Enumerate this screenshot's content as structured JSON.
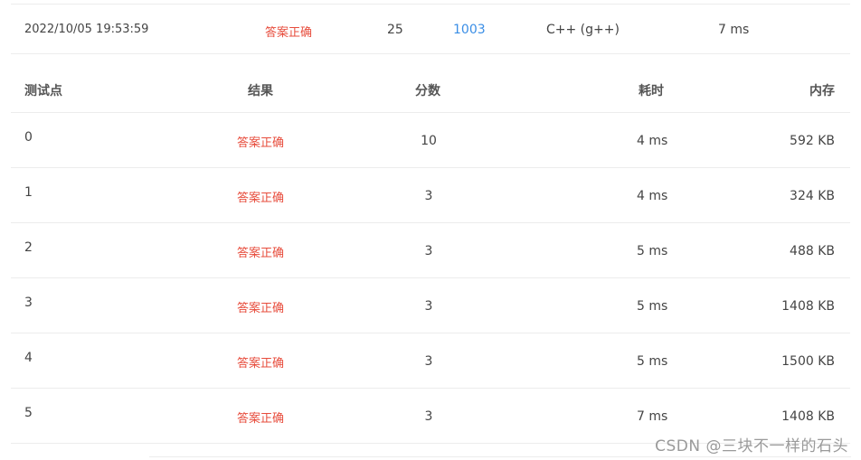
{
  "summary": {
    "submit_time": "2022/10/05 19:53:59",
    "status": "答案正确",
    "score": "25",
    "problem_id": "1003",
    "language": "C++ (g++)",
    "time": "7 ms"
  },
  "table": {
    "headers": {
      "point": "测试点",
      "result": "结果",
      "score": "分数",
      "time": "耗时",
      "memory": "内存"
    },
    "rows": [
      {
        "point": "0",
        "result": "答案正确",
        "score": "10",
        "time": "4 ms",
        "memory": "592 KB"
      },
      {
        "point": "1",
        "result": "答案正确",
        "score": "3",
        "time": "4 ms",
        "memory": "324 KB"
      },
      {
        "point": "2",
        "result": "答案正确",
        "score": "3",
        "time": "5 ms",
        "memory": "488 KB"
      },
      {
        "point": "3",
        "result": "答案正确",
        "score": "3",
        "time": "5 ms",
        "memory": "1408 KB"
      },
      {
        "point": "4",
        "result": "答案正确",
        "score": "3",
        "time": "5 ms",
        "memory": "1500 KB"
      },
      {
        "point": "5",
        "result": "答案正确",
        "score": "3",
        "time": "7 ms",
        "memory": "1408 KB"
      }
    ]
  },
  "watermark": "CSDN @三块不一样的石头",
  "colors": {
    "accepted": "#e74c3c",
    "link": "#3a8ee6",
    "divider": "#ececec"
  }
}
